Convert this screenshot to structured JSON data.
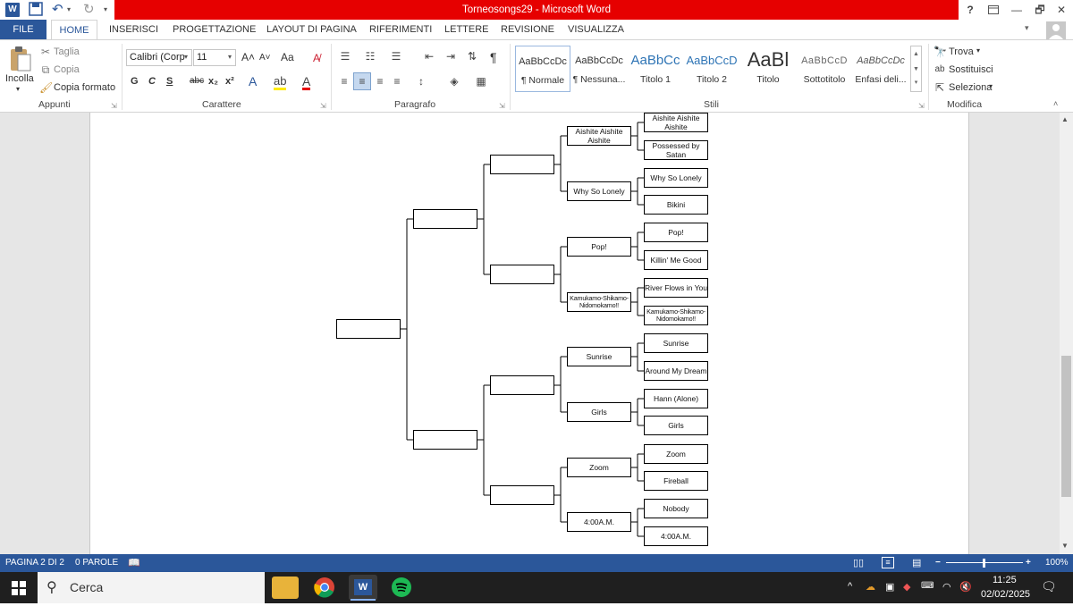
{
  "window": {
    "title": "Torneosongs29 -  Microsoft Word"
  },
  "quick_access": {
    "save_icon": "save-icon",
    "undo_icon": "undo-icon",
    "redo_icon": "redo-icon",
    "word_icon": "word-logo-icon"
  },
  "title_buttons": {
    "help": "?",
    "restore_ribbon": "ribbon-display-icon",
    "minimize": "—",
    "maximize": "🗗",
    "close": "✕"
  },
  "tabs": [
    "FILE",
    "HOME",
    "INSERISCI",
    "PROGETTAZIONE",
    "LAYOUT DI PAGINA",
    "RIFERIMENTI",
    "LETTERE",
    "REVISIONE",
    "VISUALIZZA"
  ],
  "active_tab": "HOME",
  "clipboard": {
    "paste": "Incolla",
    "cut": "Taglia",
    "copy": "Copia",
    "format_painter": "Copia formato",
    "group": "Appunti"
  },
  "font": {
    "name": "Calibri (Corp",
    "size": "11",
    "bold": "G",
    "italic": "C",
    "underline": "S",
    "strike": "abc",
    "sub": "x₂",
    "sup": "x²",
    "grow": "A˄",
    "shrink": "A˅",
    "case": "Aa",
    "group": "Carattere"
  },
  "paragraph": {
    "group": "Paragrafo",
    "pilcrow": "¶"
  },
  "styles": {
    "group": "Stili",
    "items": [
      {
        "sample": "AaBbCcDc",
        "name": "¶ Normale"
      },
      {
        "sample": "AaBbCcDc",
        "name": "¶ Nessuna..."
      },
      {
        "sample": "AaBbCc",
        "name": "Titolo 1"
      },
      {
        "sample": "AaBbCcD",
        "name": "Titolo 2"
      },
      {
        "sample": "AaBl",
        "name": "Titolo"
      },
      {
        "sample": "AaBbCcD",
        "name": "Sottotitolo"
      },
      {
        "sample": "AaBbCcDc",
        "name": "Enfasi deli..."
      }
    ]
  },
  "editing": {
    "find": "Trova",
    "replace": "Sostituisci",
    "select": "Seleziona",
    "group": "Modifica"
  },
  "bracket": {
    "round1": [
      "Aishite Aishite Aishite",
      "Possessed by Satan",
      "Why So Lonely",
      "Bikini",
      "Pop!",
      "Killin' Me Good",
      "River Flows in You",
      "Kamukamo-Shikamo-Nidomokamo!!",
      "Sunrise",
      "Around My Dream",
      "Hann (Alone)",
      "Girls",
      "Zoom",
      "Fireball",
      "Nobody",
      "4:00A.M."
    ],
    "round2": [
      "Aishite Aishite Aishite",
      "Why So Lonely",
      "Pop!",
      "Kamukamo-Shikamo-Nidomokamo!!",
      "Sunrise",
      "Girls",
      "Zoom",
      "4:00A.M."
    ],
    "round3": [
      "",
      "",
      "",
      ""
    ],
    "round4": [
      "",
      ""
    ],
    "final": [
      ""
    ]
  },
  "statusbar": {
    "page": "PAGINA 2 DI 2",
    "words": "0 PAROLE",
    "zoom": "100%"
  },
  "taskbar": {
    "search": "Cerca",
    "time": "11:25",
    "date": "02/02/2025"
  }
}
